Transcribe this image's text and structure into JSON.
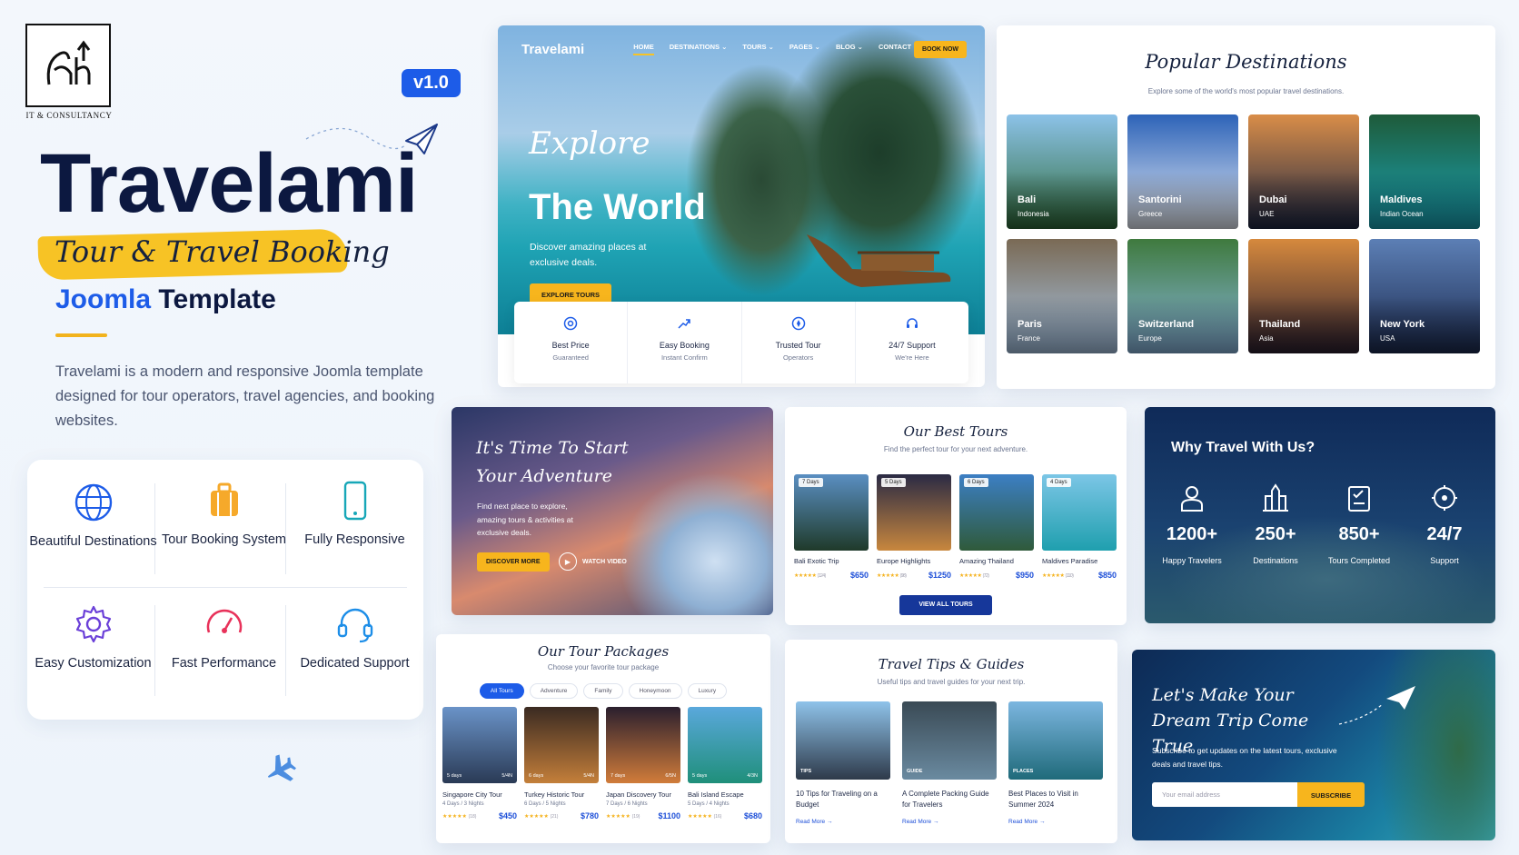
{
  "logo": {
    "caption": "IT & CONSULTANCY"
  },
  "promo": {
    "version": "v1.0",
    "brand": "Travelami",
    "tagline": "Tour & Travel Booking",
    "platform": "Joomla",
    "platform_suffix": " Template",
    "description": "Travelami is a modern and responsive Joomla template designed for tour operators, travel agencies, and booking websites."
  },
  "features": [
    {
      "icon": "globe-icon",
      "label": "Beautiful Destinations"
    },
    {
      "icon": "suitcase-icon",
      "label": "Tour Booking System"
    },
    {
      "icon": "smartphone-icon",
      "label": "Fully Responsive"
    },
    {
      "icon": "gear-icon",
      "label": "Easy Customization"
    },
    {
      "icon": "speedometer-icon",
      "label": "Fast Performance"
    },
    {
      "icon": "headset-icon",
      "label": "Dedicated Support"
    }
  ],
  "hero": {
    "logo": "Travelami",
    "menu": [
      "HOME",
      "DESTINATIONS ⌄",
      "TOURS ⌄",
      "PAGES ⌄",
      "BLOG ⌄",
      "CONTACT"
    ],
    "book_now": "BOOK NOW",
    "title_script": "Explore",
    "title_main": "The World",
    "subtitle": "Discover amazing places at exclusive deals.",
    "cta": "EXPLORE TOURS",
    "perks": [
      {
        "title": "Best Price",
        "sub": "Guaranteed"
      },
      {
        "title": "Easy Booking",
        "sub": "Instant Confirm"
      },
      {
        "title": "Trusted Tour",
        "sub": "Operators"
      },
      {
        "title": "24/7 Support",
        "sub": "We're Here"
      }
    ]
  },
  "popular": {
    "title": "Popular Destinations",
    "subtitle": "Explore some of the world's most popular travel destinations.",
    "items": [
      {
        "name": "Bali",
        "country": "Indonesia",
        "c1": "#2f6b3a",
        "c2": "#8cc2e8"
      },
      {
        "name": "Santorini",
        "country": "Greece",
        "c1": "#e9eef6",
        "c2": "#2d63b8"
      },
      {
        "name": "Dubai",
        "country": "UAE",
        "c1": "#1d2744",
        "c2": "#d98d48"
      },
      {
        "name": "Maldives",
        "country": "Indian Ocean",
        "c1": "#1aa4b6",
        "c2": "#1e5b3a"
      },
      {
        "name": "Paris",
        "country": "France",
        "c1": "#a8c6e6",
        "c2": "#7a6a55"
      },
      {
        "name": "Switzerland",
        "country": "Europe",
        "c1": "#8ab7df",
        "c2": "#3f7a3e"
      },
      {
        "name": "Thailand",
        "country": "Asia",
        "c1": "#2c2030",
        "c2": "#d6893d"
      },
      {
        "name": "New York",
        "country": "USA",
        "c1": "#1c2b50",
        "c2": "#5c7fb5"
      }
    ]
  },
  "adventure": {
    "title": "It's Time To Start Your Adventure",
    "text": "Find next place to explore, amazing tours & activities at exclusive deals.",
    "cta": "DISCOVER MORE",
    "watch": "WATCH VIDEO"
  },
  "best_tours": {
    "title": "Our Best Tours",
    "subtitle": "Find the perfect tour for your next adventure.",
    "items": [
      {
        "days": "7 Days",
        "name": "Bali Exotic Trip",
        "reviews": "(124)",
        "price": "$650",
        "c1": "#5a8fc2",
        "c2": "#1f3a2a"
      },
      {
        "days": "5 Days",
        "name": "Europe Highlights",
        "reviews": "(98)",
        "price": "$1250",
        "c1": "#2a2a44",
        "c2": "#c8873e"
      },
      {
        "days": "6 Days",
        "name": "Amazing Thailand",
        "reviews": "(72)",
        "price": "$950",
        "c1": "#3c7fc4",
        "c2": "#2f5a3a"
      },
      {
        "days": "4 Days",
        "name": "Maldives Paradise",
        "reviews": "(110)",
        "price": "$850",
        "c1": "#7cc6e6",
        "c2": "#1f9fae"
      }
    ],
    "cta": "VIEW ALL TOURS"
  },
  "why": {
    "title": "Why Travel With Us?",
    "stats": [
      {
        "icon": "user-icon",
        "num": "1200+",
        "label": "Happy Travelers"
      },
      {
        "icon": "landmark-icon",
        "num": "250+",
        "label": "Destinations"
      },
      {
        "icon": "checklist-icon",
        "num": "850+",
        "label": "Tours Completed"
      },
      {
        "icon": "support-icon",
        "num": "24/7",
        "label": "Support"
      }
    ]
  },
  "packages": {
    "title": "Our Tour Packages",
    "subtitle": "Choose your favorite tour package",
    "filters": [
      "All Tours",
      "Adventure",
      "Family",
      "Honeymoon",
      "Luxury"
    ],
    "items": [
      {
        "meta_l": "5 days",
        "meta_r": "5/4N",
        "name": "Singapore City Tour",
        "dur": "4 Days / 3 Nights",
        "reviews": "(18)",
        "price": "$450",
        "c1": "#6a93c8",
        "c2": "#2a3a55"
      },
      {
        "meta_l": "6 days",
        "meta_r": "5/4N",
        "name": "Turkey Historic Tour",
        "dur": "6 Days / 5 Nights",
        "reviews": "(21)",
        "price": "$780",
        "c1": "#3a2a22",
        "c2": "#c47f3a"
      },
      {
        "meta_l": "7 days",
        "meta_r": "6/5N",
        "name": "Japan Discovery Tour",
        "dur": "7 Days / 6 Nights",
        "reviews": "(19)",
        "price": "$1100",
        "c1": "#2a1f2e",
        "c2": "#d17c3a"
      },
      {
        "meta_l": "5 days",
        "meta_r": "4/3N",
        "name": "Bali Island Escape",
        "dur": "5 Days / 4 Nights",
        "reviews": "(16)",
        "price": "$680",
        "c1": "#5aa8dc",
        "c2": "#1f8f7a"
      }
    ]
  },
  "tips": {
    "title": "Travel Tips & Guides",
    "subtitle": "Useful tips and travel guides for your next trip.",
    "items": [
      {
        "tag": "TIPS",
        "name": "10 Tips for Traveling on a Budget",
        "more": "Read More →",
        "c1": "#8fc3ea",
        "c2": "#2e3a4a"
      },
      {
        "tag": "GUIDE",
        "name": "A Complete Packing Guide for Travelers",
        "more": "Read More →",
        "c1": "#3a4a55",
        "c2": "#6a8aa0"
      },
      {
        "tag": "PLACES",
        "name": "Best Places to Visit in Summer 2024",
        "more": "Read More →",
        "c1": "#7cb6e0",
        "c2": "#1f6a7a"
      }
    ]
  },
  "newsletter": {
    "title": "Let's Make Your Dream Trip Come True",
    "text": "Subscribe to get updates on the latest tours, exclusive deals and travel tips.",
    "placeholder": "Your email address",
    "cta": "SUBSCRIBE"
  }
}
